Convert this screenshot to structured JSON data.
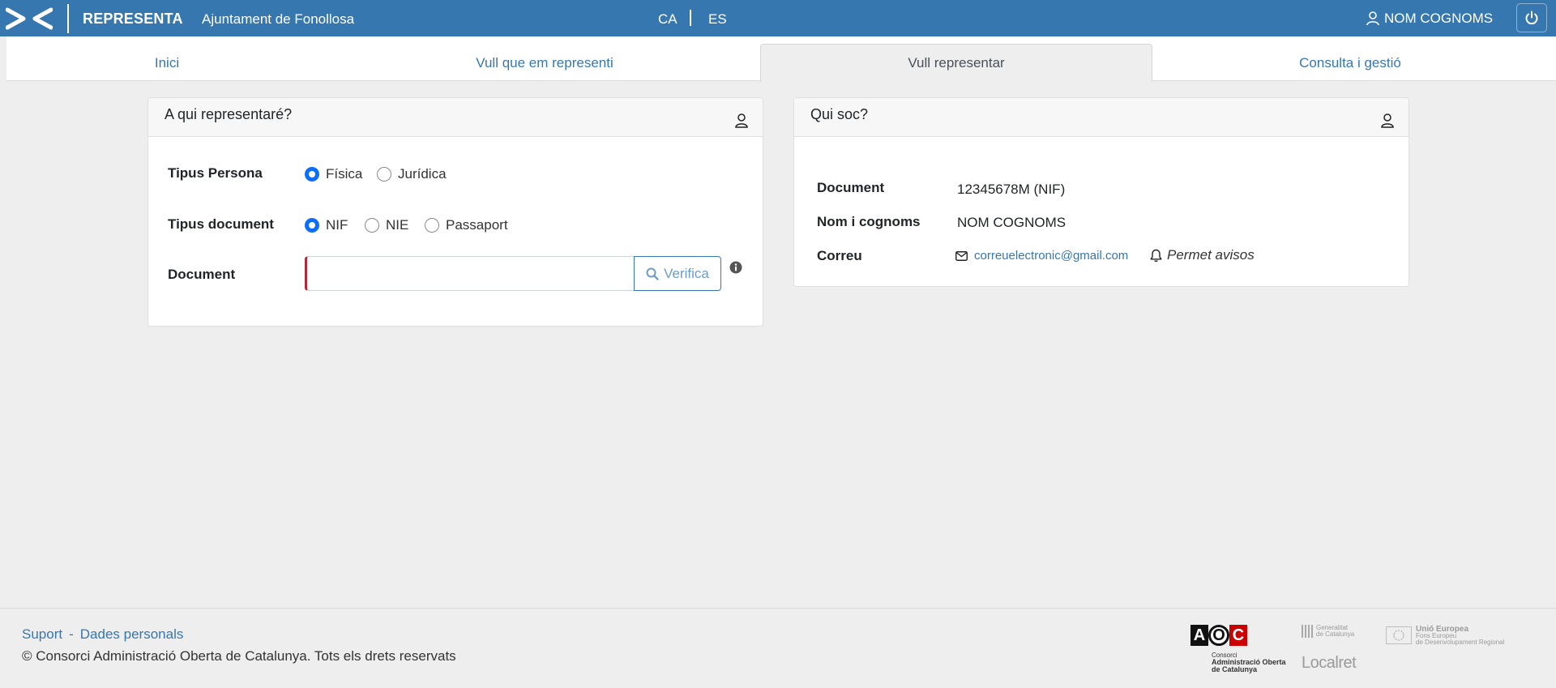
{
  "header": {
    "app_name": "REPRESENTA",
    "organization": "Ajuntament de Fonollosa",
    "languages": [
      "CA",
      "ES"
    ],
    "user_name": "NOM COGNOMS",
    "brand_color": "#3777b0"
  },
  "tabs": [
    {
      "label": "Inici",
      "active": false
    },
    {
      "label": "Vull que em representi",
      "active": false
    },
    {
      "label": "Vull representar",
      "active": true
    },
    {
      "label": "Consulta i gestió",
      "active": false
    }
  ],
  "represent_card": {
    "title": "A qui representaré?",
    "person_type_label": "Tipus Persona",
    "person_type_options": [
      "Física",
      "Jurídica"
    ],
    "person_type_selected": "Física",
    "doc_type_label": "Tipus document",
    "doc_type_options": [
      "NIF",
      "NIE",
      "Passaport"
    ],
    "doc_type_selected": "NIF",
    "document_label": "Document",
    "document_value": "",
    "verify_label": "Verifica"
  },
  "whoami_card": {
    "title": "Qui soc?",
    "document_label": "Document",
    "document_value": "12345678M (NIF)",
    "name_label": "Nom i cognoms",
    "name_value": "NOM COGNOMS",
    "email_label": "Correu",
    "email_value": "correuelectronic@gmail.com",
    "notify_label": "Permet avisos"
  },
  "footer": {
    "support_link": "Suport",
    "link_separator": "-",
    "personal_data_link": "Dades personals",
    "copyright": "© Consorci Administració Oberta de Catalunya. Tots els drets reservats",
    "logos": {
      "aoc_letters": [
        "A",
        "O",
        "C"
      ],
      "aoc_small": "Consorci",
      "aoc_name_1": "Administració Oberta",
      "aoc_name_2": "de Catalunya",
      "gencat_1": "Generalitat",
      "gencat_2": "de Catalunya",
      "localret": "Localret",
      "eu_1": "Unió Europea",
      "eu_2": "Fons Europeu",
      "eu_3": "de Desenvolupament Regional"
    }
  }
}
